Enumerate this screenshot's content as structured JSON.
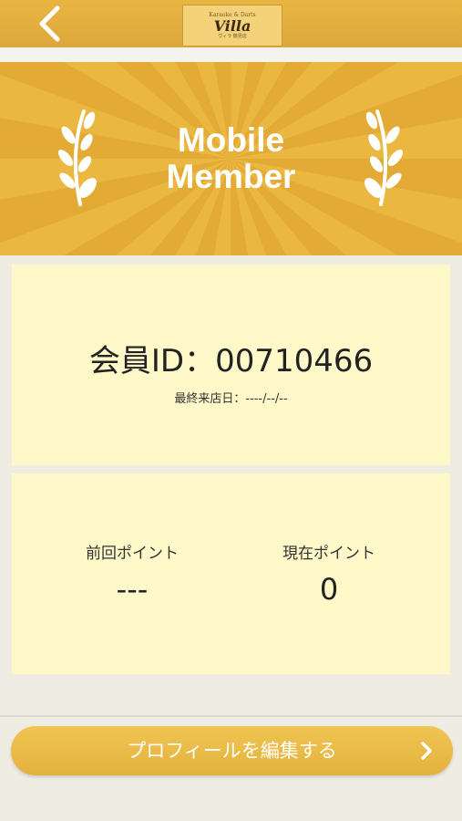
{
  "header": {
    "back_icon": "chevron-left-icon",
    "logo": {
      "top_text": "Karaoke & Darts",
      "brand": "Villa",
      "sub_text": "ヴィラ 鶴見店"
    }
  },
  "hero": {
    "title_line1": "Mobile",
    "title_line2": "Member"
  },
  "member": {
    "id_text": "会員ID：00710466",
    "last_visit": "最終来店日：----/--/--"
  },
  "points": {
    "previous_label": "前回ポイント",
    "previous_value": "---",
    "current_label": "現在ポイント",
    "current_value": "0"
  },
  "actions": {
    "edit_profile_label": "プロフィールを編集する",
    "edit_profile_icon": "chevron-right-icon"
  },
  "colors": {
    "accent": "#e8b440",
    "card_bg": "#fff8c9",
    "page_bg": "#efece4"
  }
}
